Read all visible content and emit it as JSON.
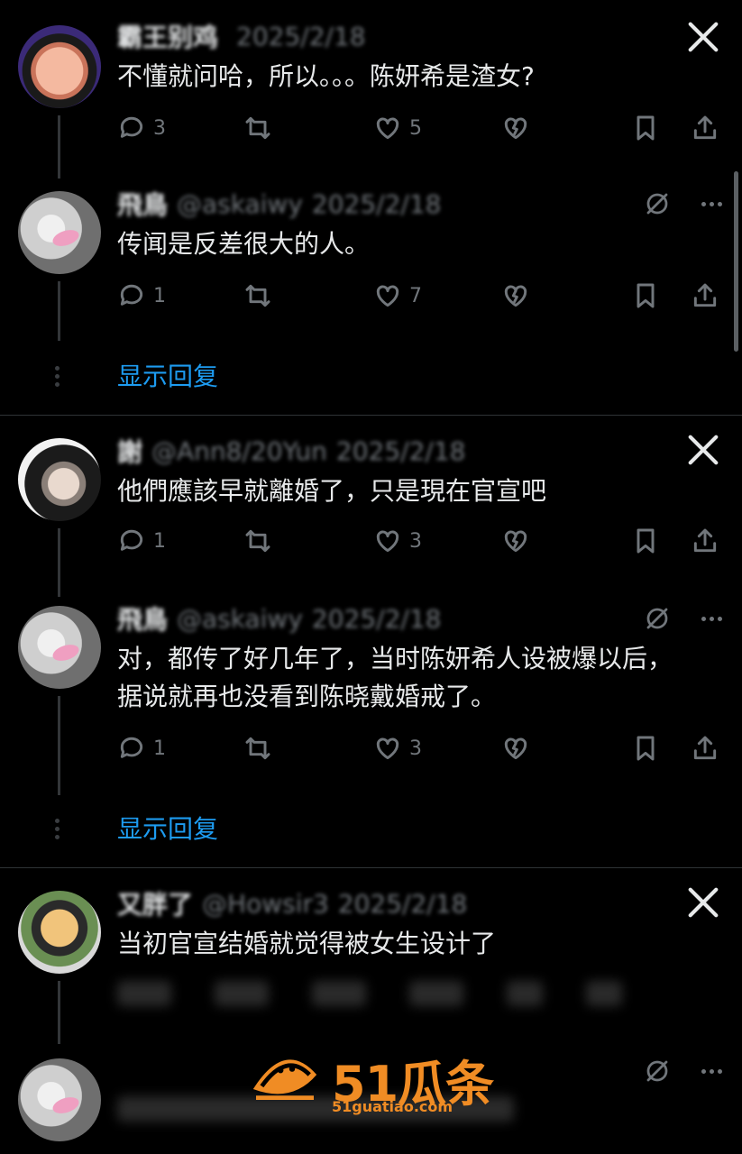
{
  "posts": [
    {
      "name": "霸王别鸡",
      "handle": "",
      "date": "2025/2/18",
      "text": "不懂就问哈，所以。。。陈妍希是渣女?",
      "replies": "3",
      "likes": "5"
    },
    {
      "name": "飛鳥",
      "handle": "@askaiwy",
      "date": "2025/2/18",
      "text": "传闻是反差很大的人。",
      "replies": "1",
      "likes": "7"
    },
    {
      "name": "謝",
      "handle": "@Ann8/20Yun",
      "date": "2025/2/18",
      "text": "他們應該早就離婚了，只是現在官宣吧",
      "replies": "1",
      "likes": "3"
    },
    {
      "name": "飛鳥",
      "handle": "@askaiwy",
      "date": "2025/2/18",
      "text": "对，都传了好几年了，当时陈妍希人设被爆以后，据说就再也没看到陈晓戴婚戒了。",
      "replies": "1",
      "likes": "3"
    },
    {
      "name": "又胖了",
      "handle": "@Howsir3",
      "date": "2025/2/18",
      "text": "当初官宣结婚就觉得被女生设计了"
    }
  ],
  "show_replies_label": "显示回复",
  "watermark": {
    "brand": "51瓜条",
    "url": "51guatiao.com",
    "color": "#f08c24"
  },
  "colors": {
    "background": "#000000",
    "text": "#e7e9ea",
    "muted": "#71767b",
    "link": "#1d9bf0"
  },
  "icons": [
    "reply-icon",
    "retweet-icon",
    "like-icon",
    "broken-heart-icon",
    "bookmark-icon",
    "share-icon",
    "x-logo-icon",
    "mute-icon",
    "more-icon"
  ]
}
